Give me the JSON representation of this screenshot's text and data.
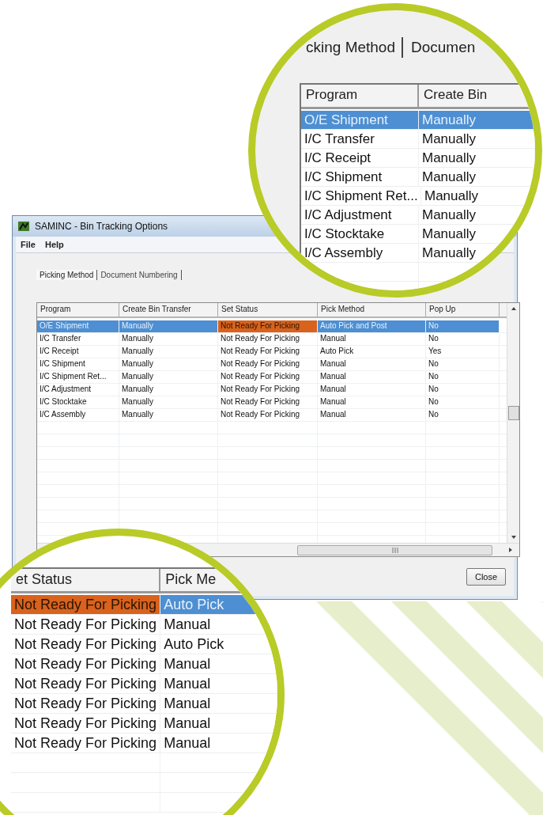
{
  "window": {
    "title": "SAMINC - Bin Tracking Options",
    "menu": [
      "File",
      "Help"
    ],
    "tabs": [
      {
        "label": "Picking Method",
        "selected": true
      },
      {
        "label": "Document Numbering",
        "selected": false
      }
    ],
    "table": {
      "columns": [
        "Program",
        "Create Bin Transfer",
        "Set Status",
        "Pick Method",
        "Pop Up"
      ],
      "rows": [
        {
          "selected": true,
          "cells": [
            {
              "text": "O/E Shipment",
              "focused": false
            },
            {
              "text": "Manually",
              "focused": false
            },
            {
              "text": "Not Ready For Picking",
              "focused": true
            },
            {
              "text": "Auto Pick and Post",
              "focused": false
            },
            {
              "text": "No",
              "focused": false
            }
          ]
        },
        {
          "selected": false,
          "cells": [
            {
              "text": "I/C Transfer",
              "focused": false
            },
            {
              "text": "Manually",
              "focused": false
            },
            {
              "text": "Not Ready For Picking",
              "focused": false
            },
            {
              "text": "Manual",
              "focused": false
            },
            {
              "text": "No",
              "focused": false
            }
          ]
        },
        {
          "selected": false,
          "cells": [
            {
              "text": "I/C Receipt",
              "focused": false
            },
            {
              "text": "Manually",
              "focused": false
            },
            {
              "text": "Not Ready For Picking",
              "focused": false
            },
            {
              "text": "Auto Pick",
              "focused": false
            },
            {
              "text": "Yes",
              "focused": false
            }
          ]
        },
        {
          "selected": false,
          "cells": [
            {
              "text": "I/C Shipment",
              "focused": false
            },
            {
              "text": "Manually",
              "focused": false
            },
            {
              "text": "Not Ready For Picking",
              "focused": false
            },
            {
              "text": "Manual",
              "focused": false
            },
            {
              "text": "No",
              "focused": false
            }
          ]
        },
        {
          "selected": false,
          "cells": [
            {
              "text": "I/C Shipment Ret...",
              "focused": false
            },
            {
              "text": "Manually",
              "focused": false
            },
            {
              "text": "Not Ready For Picking",
              "focused": false
            },
            {
              "text": "Manual",
              "focused": false
            },
            {
              "text": "No",
              "focused": false
            }
          ]
        },
        {
          "selected": false,
          "cells": [
            {
              "text": "I/C Adjustment",
              "focused": false
            },
            {
              "text": "Manually",
              "focused": false
            },
            {
              "text": "Not Ready For Picking",
              "focused": false
            },
            {
              "text": "Manual",
              "focused": false
            },
            {
              "text": "No",
              "focused": false
            }
          ]
        },
        {
          "selected": false,
          "cells": [
            {
              "text": "I/C Stocktake",
              "focused": false
            },
            {
              "text": "Manually",
              "focused": false
            },
            {
              "text": "Not Ready For Picking",
              "focused": false
            },
            {
              "text": "Manual",
              "focused": false
            },
            {
              "text": "No",
              "focused": false
            }
          ]
        },
        {
          "selected": false,
          "cells": [
            {
              "text": "I/C Assembly",
              "focused": false
            },
            {
              "text": "Manually",
              "focused": false
            },
            {
              "text": "Not Ready For Picking",
              "focused": false
            },
            {
              "text": "Manual",
              "focused": false
            },
            {
              "text": "No",
              "focused": false
            }
          ]
        }
      ]
    },
    "buttons": [
      "Close"
    ]
  },
  "magnifier_top": {
    "tabs": [
      {
        "label": "cking Method",
        "selected": true
      },
      {
        "label": "Documen",
        "selected": false
      }
    ],
    "columns": [
      "Program",
      "Create Bin"
    ],
    "rows": [
      {
        "selected": true,
        "cells": [
          {
            "text": "O/E Shipment",
            "focused": false
          },
          {
            "text": "Manually",
            "focused": false
          }
        ]
      },
      {
        "selected": false,
        "cells": [
          {
            "text": "I/C Transfer",
            "focused": false
          },
          {
            "text": "Manually",
            "focused": false
          }
        ]
      },
      {
        "selected": false,
        "cells": [
          {
            "text": "I/C Receipt",
            "focused": false
          },
          {
            "text": "Manually",
            "focused": false
          }
        ]
      },
      {
        "selected": false,
        "cells": [
          {
            "text": "I/C Shipment",
            "focused": false
          },
          {
            "text": "Manually",
            "focused": false
          }
        ]
      },
      {
        "selected": false,
        "cells": [
          {
            "text": "I/C Shipment Ret...",
            "focused": false
          },
          {
            "text": "Manually",
            "focused": false
          }
        ]
      },
      {
        "selected": false,
        "cells": [
          {
            "text": "I/C Adjustment",
            "focused": false
          },
          {
            "text": "Manually",
            "focused": false
          }
        ]
      },
      {
        "selected": false,
        "cells": [
          {
            "text": "I/C Stocktake",
            "focused": false
          },
          {
            "text": "Manually",
            "focused": false
          }
        ]
      },
      {
        "selected": false,
        "cells": [
          {
            "text": "I/C Assembly",
            "focused": false
          },
          {
            "text": "Manually",
            "focused": false
          }
        ]
      }
    ]
  },
  "magnifier_bottom": {
    "columns": [
      "et Status",
      "Pick Me"
    ],
    "rows": [
      {
        "selected": true,
        "cells": [
          {
            "text": "Not Ready For Picking",
            "focused": true
          },
          {
            "text": "Auto Pick",
            "focused": false
          }
        ]
      },
      {
        "selected": false,
        "cells": [
          {
            "text": "Not Ready For Picking",
            "focused": false
          },
          {
            "text": "Manual",
            "focused": false
          }
        ]
      },
      {
        "selected": false,
        "cells": [
          {
            "text": "Not Ready For Picking",
            "focused": false
          },
          {
            "text": "Auto Pick",
            "focused": false
          }
        ]
      },
      {
        "selected": false,
        "cells": [
          {
            "text": "Not Ready For Picking",
            "focused": false
          },
          {
            "text": "Manual",
            "focused": false
          }
        ]
      },
      {
        "selected": false,
        "cells": [
          {
            "text": "Not Ready For Picking",
            "focused": false
          },
          {
            "text": "Manual",
            "focused": false
          }
        ]
      },
      {
        "selected": false,
        "cells": [
          {
            "text": "Not Ready For Picking",
            "focused": false
          },
          {
            "text": "Manual",
            "focused": false
          }
        ]
      },
      {
        "selected": false,
        "cells": [
          {
            "text": "Not Ready For Picking",
            "focused": false
          },
          {
            "text": "Manual",
            "focused": false
          }
        ]
      },
      {
        "selected": false,
        "cells": [
          {
            "text": "Not Ready For Picking",
            "focused": false
          },
          {
            "text": "Manual",
            "focused": false
          }
        ]
      }
    ]
  }
}
